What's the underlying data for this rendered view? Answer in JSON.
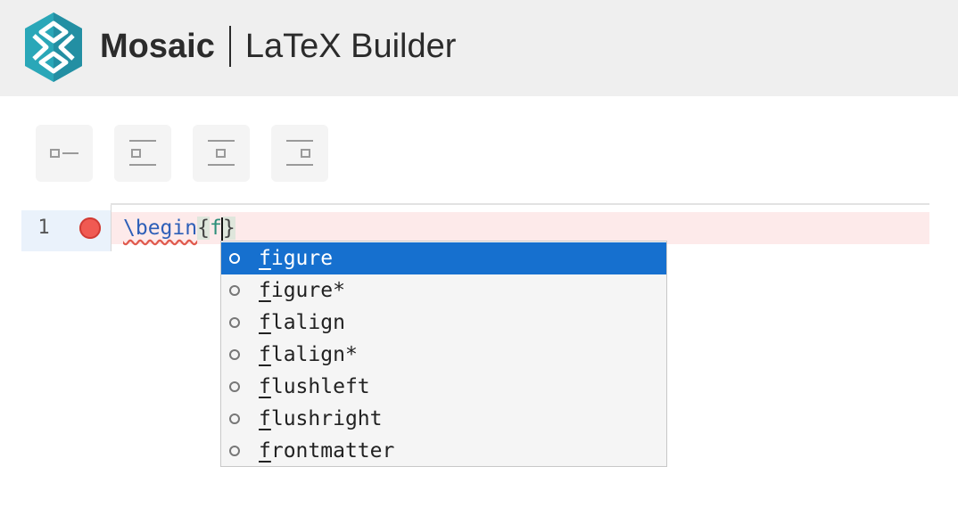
{
  "header": {
    "brand_name": "Mosaic",
    "product_name": "LaTeX Builder",
    "colors": {
      "background": "#efefef",
      "logo_primary": "#2aa7b8",
      "logo_dark": "#1d7f94"
    }
  },
  "toolbar": {
    "buttons": [
      {
        "name": "insert-left-align-icon",
        "icon": "align-left-inline"
      },
      {
        "name": "insert-align-left-icon",
        "icon": "align-left-block"
      },
      {
        "name": "insert-align-center-icon",
        "icon": "align-center-block"
      },
      {
        "name": "insert-align-right-icon",
        "icon": "align-right-block"
      }
    ]
  },
  "editor": {
    "line_number": "1",
    "code": {
      "command": "\\begin",
      "open_brace": "{",
      "typed": "f",
      "close_brace": "}"
    },
    "colors": {
      "error_line": "#fdeaea",
      "gutter": "#eaf2fb",
      "breakpoint": "#f05a52",
      "selection": "#1670cf"
    }
  },
  "autocomplete": {
    "typed_prefix": "f",
    "selected_index": 0,
    "items": [
      {
        "first": "f",
        "rest": "igure"
      },
      {
        "first": "f",
        "rest": "igure*"
      },
      {
        "first": "f",
        "rest": "lalign"
      },
      {
        "first": "f",
        "rest": "lalign*"
      },
      {
        "first": "f",
        "rest": "lushleft"
      },
      {
        "first": "f",
        "rest": "lushright"
      },
      {
        "first": "f",
        "rest": "rontmatter"
      }
    ]
  }
}
